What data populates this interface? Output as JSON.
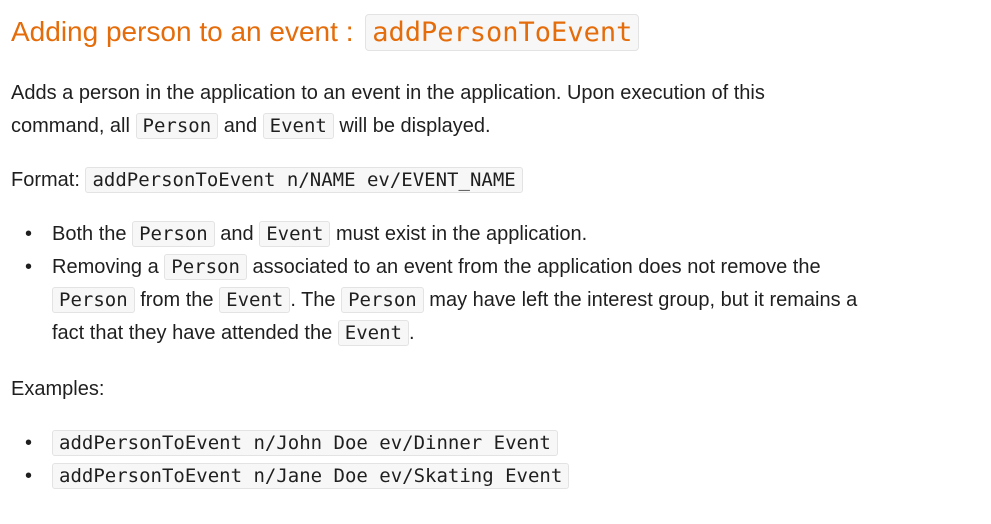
{
  "heading": {
    "text": "Adding person to an event : ",
    "code": "addPersonToEvent"
  },
  "description": {
    "line1": "Adds a person in the application to an event in the application. Upon execution of this",
    "line2_prefix": "command, all ",
    "code1": "Person",
    "and": " and ",
    "code2": "Event",
    "line2_suffix": " will be displayed."
  },
  "format": {
    "label": "Format: ",
    "code": "addPersonToEvent n/NAME ev/EVENT_NAME"
  },
  "notes": {
    "item1": {
      "prefix": "Both the ",
      "code1": "Person",
      "mid": " and ",
      "code2": "Event",
      "suffix": " must exist in the application."
    },
    "item2": {
      "line1_prefix": "Removing a ",
      "line1_code": "Person",
      "line1_suffix": " associated to an event from the application does not remove the",
      "line2_code1": "Person",
      "line2_mid1": " from the ",
      "line2_code2": "Event",
      "line2_mid2": ". The ",
      "line2_code3": "Person",
      "line2_suffix": " may have left the interest group, but it remains a",
      "line3_prefix": "fact that they have attended the ",
      "line3_code": "Event",
      "line3_suffix": "."
    }
  },
  "examples": {
    "label": "Examples:",
    "items": [
      "addPersonToEvent n/John Doe ev/Dinner Event",
      "addPersonToEvent n/Jane Doe ev/Skating Event"
    ]
  },
  "bullet_glyph": "•"
}
